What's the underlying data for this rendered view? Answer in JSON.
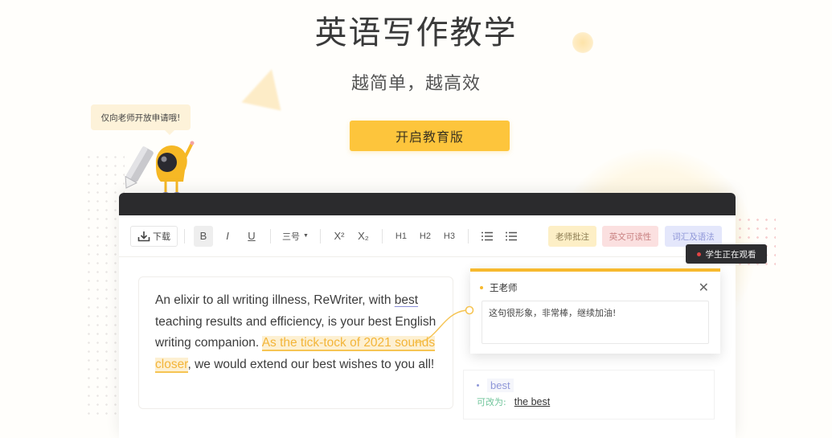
{
  "hero": {
    "title": "英语写作教学",
    "subtitle": "越简单，越高效",
    "cta_label": "开启教育版"
  },
  "mascot": {
    "speech": "仅向老师开放申请哦!"
  },
  "toolbar": {
    "download_label": "下载",
    "bold": "B",
    "italic": "I",
    "underline": "U",
    "font_size": "三号",
    "superscript": "X²",
    "subscript": "X₂",
    "h1": "H1",
    "h2": "H2",
    "h3": "H3",
    "tags": {
      "teacher_comments": "老师批注",
      "readability": "英文可读性",
      "vocab_grammar": "词汇及语法"
    }
  },
  "status": {
    "watching": "学生正在观看"
  },
  "essay": {
    "part1": "An elixir to all writing illness, ReWriter, with ",
    "marked_word": "best",
    "part2": " teaching results and efficiency, is your best English writing companion. ",
    "highlight": "As the tick-tock of 2021 sounds closer",
    "part3": ", we would extend our best wishes to you all!"
  },
  "comment": {
    "author": "王老师",
    "text": "这句很形象，非常棒，继续加油!"
  },
  "suggestion": {
    "word": "best",
    "label": "可改为:",
    "fix": "the best"
  },
  "colors": {
    "accent": "#fdc53c",
    "comment_border": "#f7b92e",
    "highlight_text": "#f3b53a",
    "grammar": "#8f97d8",
    "suggest_label": "#6fc49a"
  }
}
